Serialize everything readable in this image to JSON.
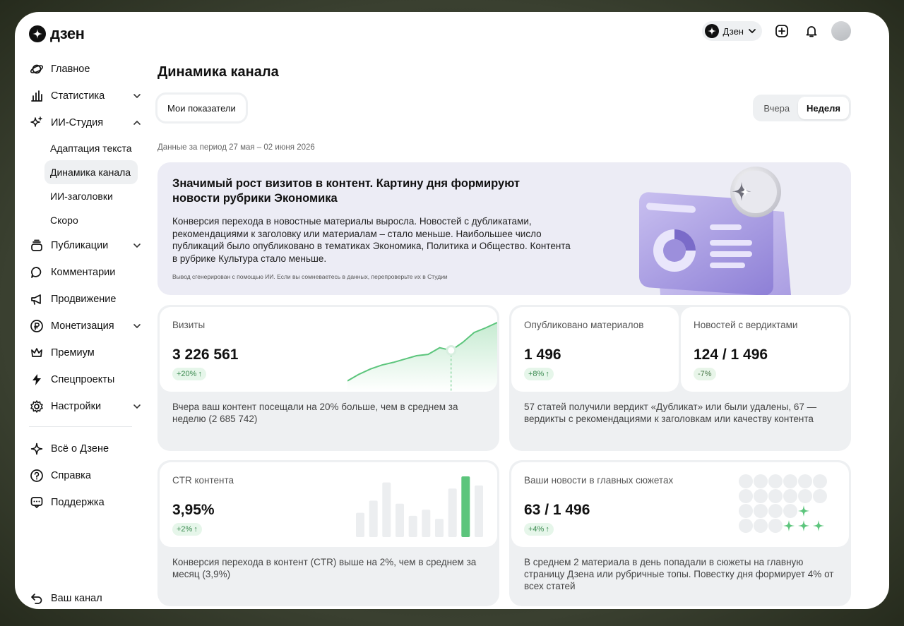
{
  "brand": {
    "logo_text": "дзен"
  },
  "topbar": {
    "channel_label": "Дзен"
  },
  "sidebar": {
    "items": [
      {
        "label": "Главное"
      },
      {
        "label": "Статистика"
      },
      {
        "label": "ИИ-Студия"
      },
      {
        "label": "Публикации"
      },
      {
        "label": "Комментарии"
      },
      {
        "label": "Продвижение"
      },
      {
        "label": "Монетизация"
      },
      {
        "label": "Премиум"
      },
      {
        "label": "Спецпроекты"
      },
      {
        "label": "Настройки"
      }
    ],
    "sub_items": [
      {
        "label": "Адаптация текста"
      },
      {
        "label": "Динамика канала"
      },
      {
        "label": "ИИ-заголовки"
      },
      {
        "label": "Скоро"
      }
    ],
    "extra": [
      {
        "label": "Всё о Дзене"
      },
      {
        "label": "Справка"
      },
      {
        "label": "Поддержка"
      }
    ],
    "bottom": {
      "label": "Ваш канал"
    }
  },
  "main": {
    "title": "Динамика канала",
    "my_metrics": "Мои показатели",
    "range": {
      "yesterday": "Вчера",
      "week": "Неделя",
      "selected": "Неделя"
    },
    "period": "Данные за период 27 мая – 02 июня 2026",
    "banner": {
      "headline": "Значимый рост визитов в контент. Картину дня формируют новости рубрики Экономика",
      "body": "Конверсия перехода в новостные материалы выросла. Новостей с дубликатами, рекомендациями к заголовку или материалам – стало меньше. Наибольшее число публикаций было опубликовано в тематиках Экономика, Политика и Общество. Контента в рубрике Культура стало меньше.",
      "note": "Вывод сгенерирован с помощью ИИ. Если вы сомневаетесь в данных, перепроверьте их в Студии"
    },
    "cards": {
      "visits": {
        "label": "Визиты",
        "value": "3 226 561",
        "delta": "+20%",
        "desc": "Вчера ваш контент посещали на 20% больше, чем в среднем за неделю (2 685 742)"
      },
      "published": {
        "label": "Опубликовано материалов",
        "value": "1 496",
        "delta": "+8%"
      },
      "verdicts": {
        "label": "Новостей с вердиктами",
        "value": "124 / 1 496",
        "delta": "-7%"
      },
      "published_desc": "57 статей получили вердикт «Дубликат» или были удалены, 67 — вердикты с рекомендациями к заголовкам или качеству контента",
      "ctr": {
        "label": "CTR контента",
        "value": "3,95%",
        "delta": "+2%",
        "desc": "Конверсия перехода в контент (CTR) выше на 2%, чем в среднем за месяц (3,9%)"
      },
      "stories": {
        "label": "Ваши новости в главных сюжетах",
        "value": "63 / 1 496",
        "delta": "+4%",
        "desc": "В среднем 2 материала в день попадали в сюжеты на главную страницу Дзена или рубричные топы. Повестку дня формирует 4% от всех статей"
      }
    }
  },
  "colors": {
    "accent_green": "#5cc57c",
    "banner_bg": "#ececf5",
    "card_bg": "#eef0f2",
    "illustration_purple": "#a99be0"
  },
  "sparklines": {
    "visits": [
      0.12,
      0.22,
      0.3,
      0.36,
      0.4,
      0.45,
      0.5,
      0.52,
      0.62,
      0.58,
      0.7,
      0.85,
      0.92,
      1.0
    ],
    "ctr_bars": [
      0.4,
      0.6,
      0.9,
      0.55,
      0.35,
      0.45,
      0.3,
      0.8,
      1.0,
      0.85
    ],
    "ctr_highlight_index": 8
  },
  "icons": [
    "zen-logo-icon",
    "chevron-down-icon",
    "plus-square-icon",
    "bell-icon",
    "planet-icon",
    "bar-chart-icon",
    "sparkle-icon",
    "stack-icon",
    "comment-icon",
    "megaphone-icon",
    "ruble-icon",
    "crown-icon",
    "bolt-icon",
    "gear-icon",
    "zen-outline-icon",
    "help-icon",
    "support-icon",
    "back-arrow-icon"
  ]
}
